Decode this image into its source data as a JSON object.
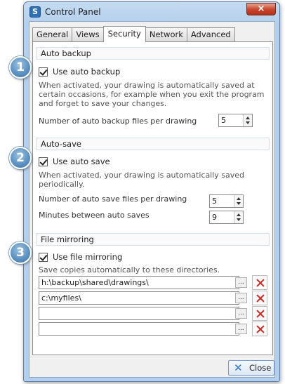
{
  "window": {
    "title": "Control Panel",
    "close_glyph": "×",
    "icon": "app-logo-icon"
  },
  "tabs": [
    {
      "label": "General",
      "active": false
    },
    {
      "label": "Views",
      "active": false
    },
    {
      "label": "Security",
      "active": true
    },
    {
      "label": "Network",
      "active": false
    },
    {
      "label": "Advanced",
      "active": false
    }
  ],
  "badges": [
    "1",
    "2",
    "3"
  ],
  "auto_backup": {
    "header": "Auto backup",
    "checkbox_label": "Use auto backup",
    "checked": true,
    "description": "When activated, your drawing is automatically saved at certain occasions, for example when you exit the program and forget to save your changes.",
    "files_label": "Number of auto backup files per drawing",
    "files_value": "5"
  },
  "auto_save": {
    "header": "Auto-save",
    "checkbox_label": "Use auto save",
    "checked": true,
    "description": "When activated, your drawing is automatically saved periodically.",
    "files_label": "Number of auto save files per drawing",
    "files_value": "5",
    "minutes_label": "Minutes between auto saves",
    "minutes_value": "9"
  },
  "file_mirroring": {
    "header": "File mirroring",
    "checkbox_label": "Use file mirroring",
    "checked": true,
    "description": "Save copies automatically to these directories.",
    "directories": [
      "h:\\backup\\shared\\drawings\\",
      "c:\\myfiles\\",
      "",
      ""
    ],
    "browse_label": "..."
  },
  "footer": {
    "close_label": "Close"
  },
  "colors": {
    "accent": "#3f74a8",
    "delete": "#c92a22",
    "frame": "#b5d0ec"
  }
}
